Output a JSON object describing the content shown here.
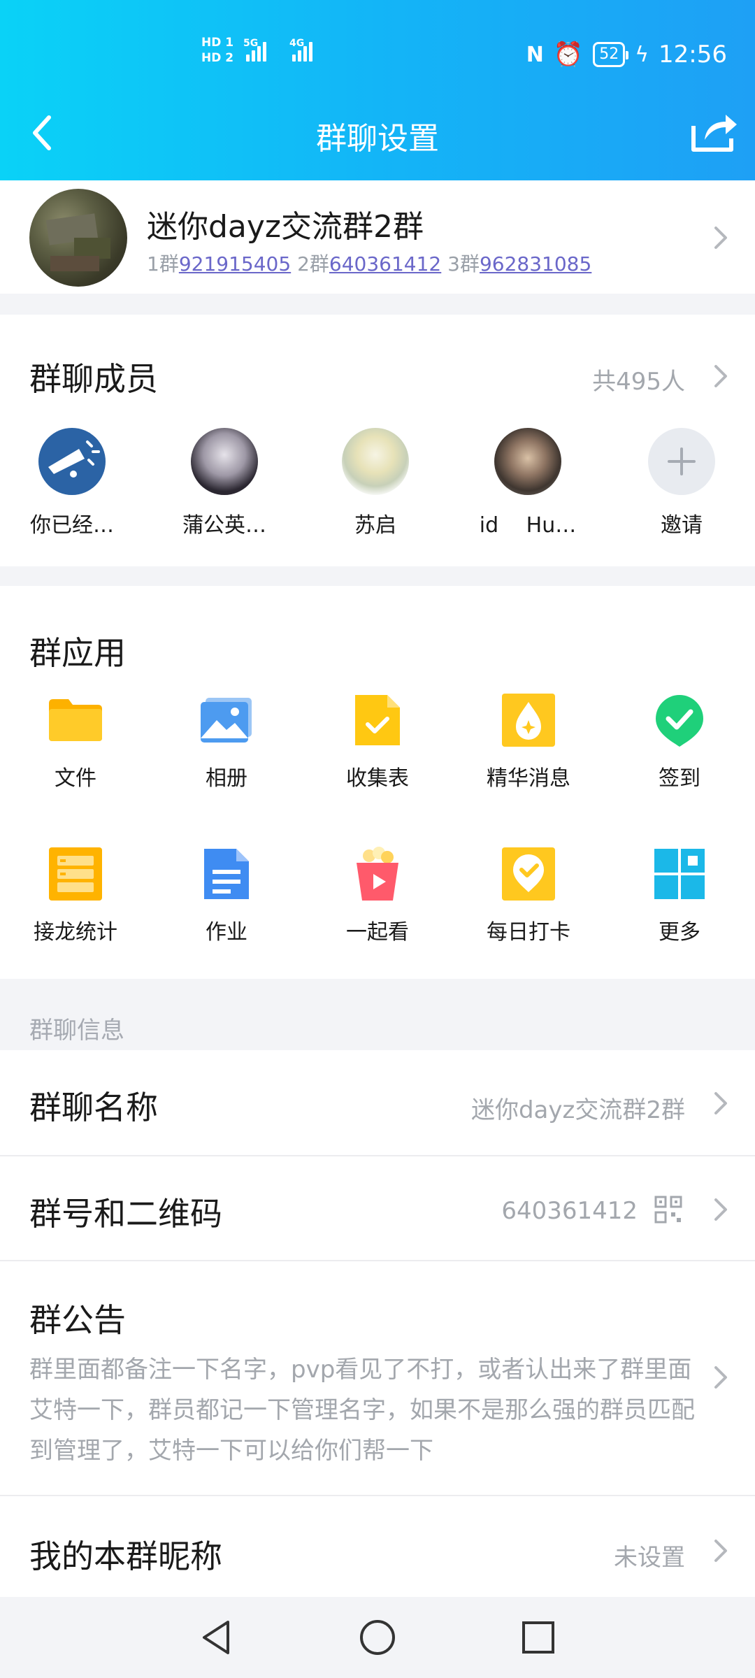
{
  "status_bar": {
    "hd1": "HD 1",
    "hd2": "HD 2",
    "net1": "5G",
    "net2": "4G",
    "battery": "52",
    "time": "12:56"
  },
  "header": {
    "title": "群聊设置"
  },
  "group": {
    "name": "迷你dayz交流群2群",
    "sub": [
      {
        "prefix": "1群",
        "id": "921915405"
      },
      {
        "prefix": "2群",
        "id": "640361412"
      },
      {
        "prefix": "3群",
        "id": "962831085"
      }
    ]
  },
  "members": {
    "title": "群聊成员",
    "count": "共495人",
    "list": [
      {
        "name": "你已经…"
      },
      {
        "name": "蒲公英…"
      },
      {
        "name": "苏启"
      },
      {
        "name": "id　 Hu…"
      },
      {
        "name": "邀请"
      }
    ]
  },
  "apps": {
    "title": "群应用",
    "items": [
      {
        "label": "文件",
        "icon": "folder-icon"
      },
      {
        "label": "相册",
        "icon": "album-icon"
      },
      {
        "label": "收集表",
        "icon": "form-icon"
      },
      {
        "label": "精华消息",
        "icon": "essence-icon"
      },
      {
        "label": "签到",
        "icon": "checkin-icon"
      },
      {
        "label": "接龙统计",
        "icon": "relay-icon"
      },
      {
        "label": "作业",
        "icon": "homework-icon"
      },
      {
        "label": "一起看",
        "icon": "watch-together-icon"
      },
      {
        "label": "每日打卡",
        "icon": "daily-punch-icon"
      },
      {
        "label": "更多",
        "icon": "more-grid-icon"
      }
    ]
  },
  "info": {
    "section_label": "群聊信息",
    "name_label": "群聊名称",
    "name_value": "迷你dayz交流群2群",
    "number_label": "群号和二维码",
    "number_value": "640361412",
    "notice_label": "群公告",
    "notice_text": "群里面都备注一下名字，pvp看见了不打，或者认出来了群里面艾特一下，群员都记一下管理名字，如果不是那么强的群员匹配到管理了，艾特一下可以给你们帮一下",
    "nick_label": "我的本群昵称",
    "nick_value": "未设置"
  },
  "colors": {
    "header_start": "#0ad2f7",
    "header_end": "#1ea0f5",
    "link": "#6a67c9",
    "muted": "#a3a7ad"
  }
}
